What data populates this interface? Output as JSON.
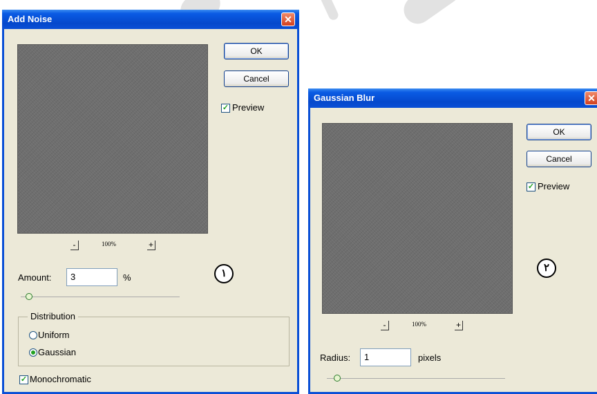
{
  "add_noise": {
    "title": "Add Noise",
    "close_glyph": "✕",
    "ok_label": "OK",
    "cancel_label": "Cancel",
    "preview_label": "Preview",
    "preview_checked": true,
    "zoom_out_label": "-",
    "zoom_level": "100%",
    "zoom_in_label": "+",
    "amount_label": "Amount:",
    "amount_value": "3",
    "amount_unit": "%",
    "amount_slider_fraction": 0.03,
    "step_badge": "١",
    "distribution_label": "Distribution",
    "distribution_options": [
      "Uniform",
      "Gaussian"
    ],
    "distribution_selected": "Gaussian",
    "monochromatic_label": "Monochromatic",
    "monochromatic_checked": true
  },
  "gaussian_blur": {
    "title": "Gaussian Blur",
    "close_glyph": "✕",
    "ok_label": "OK",
    "cancel_label": "Cancel",
    "preview_label": "Preview",
    "preview_checked": true,
    "zoom_out_label": "-",
    "zoom_level": "100%",
    "zoom_in_label": "+",
    "radius_label": "Radius:",
    "radius_value": "1",
    "radius_unit": "pixels",
    "radius_slider_fraction": 0.04,
    "step_badge": "٢"
  },
  "colors": {
    "titlebar_blue": "#0548cc",
    "dialog_face": "#ece9d8",
    "check_green": "#21a121",
    "close_red": "#d3401f"
  }
}
